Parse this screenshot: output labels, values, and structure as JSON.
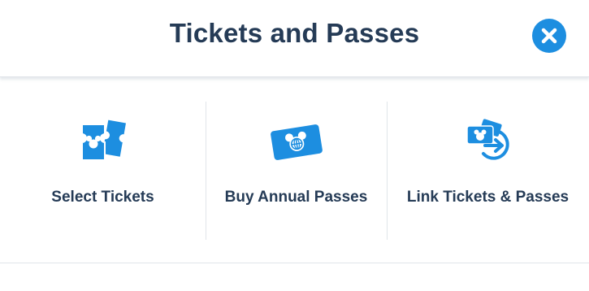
{
  "header": {
    "title": "Tickets and Passes",
    "close_icon": "close-icon"
  },
  "options": [
    {
      "label": "Select Tickets",
      "icon": "tickets-icon"
    },
    {
      "label": "Buy Annual Passes",
      "icon": "annual-pass-card-icon"
    },
    {
      "label": "Link Tickets & Passes",
      "icon": "link-tickets-icon"
    }
  ],
  "colors": {
    "accent": "#1d8ee0",
    "title_text": "#253b56",
    "divider": "#e1e5ea"
  }
}
